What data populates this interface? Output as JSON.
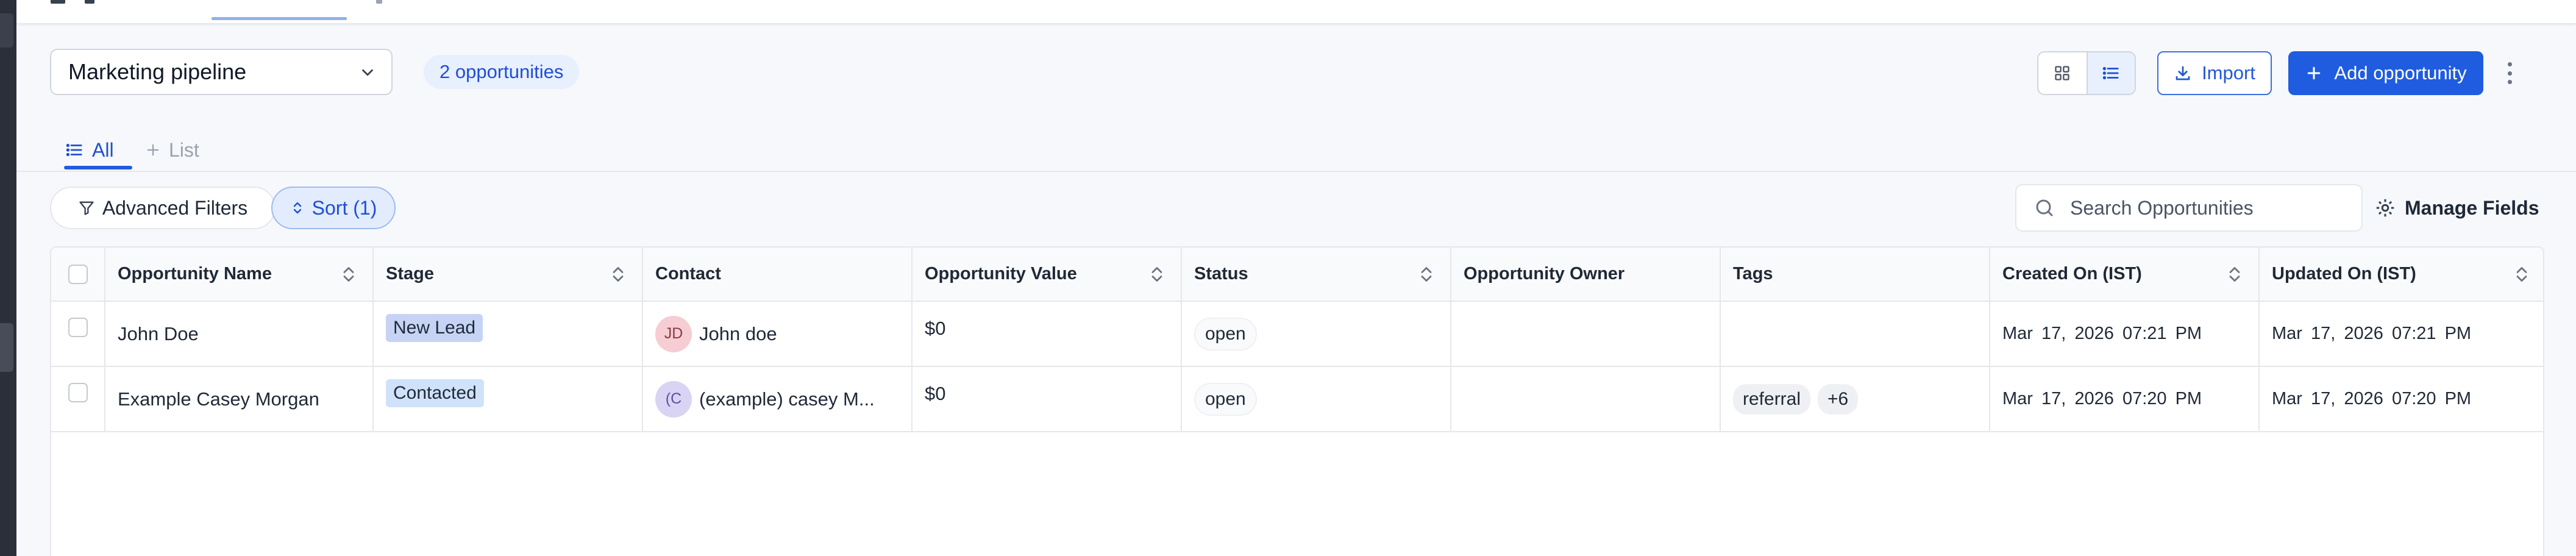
{
  "colors": {
    "accent": "#1f5ce0",
    "accent_light": "#e8f0fd",
    "border": "#e5e7eb",
    "rail": "#2b2f3a"
  },
  "header": {
    "pipeline_select": "Marketing pipeline",
    "opportunity_count": "2 opportunities",
    "import_label": "Import",
    "add_label": "Add opportunity"
  },
  "tabs": {
    "all": "All",
    "add_list": "List"
  },
  "toolbar": {
    "filters_label": "Advanced Filters",
    "sort_label": "Sort (1)",
    "search_placeholder": "Search Opportunities",
    "manage_fields_label": "Manage Fields"
  },
  "table": {
    "columns": [
      "Opportunity Name",
      "Stage",
      "Contact",
      "Opportunity Value",
      "Status",
      "Opportunity Owner",
      "Tags",
      "Created On (IST)",
      "Updated On (IST)"
    ],
    "rows": [
      {
        "name": "John Doe",
        "stage": "New Lead",
        "contact_initials": "JD",
        "contact_name": "John doe",
        "value": "$0",
        "status": "open",
        "owner": "",
        "tags": [],
        "tags_more": "",
        "created": "Mar 17, 2026 07:21 PM",
        "updated": "Mar 17, 2026 07:21 PM"
      },
      {
        "name": "Example Casey Morgan",
        "stage": "Contacted",
        "contact_initials": "(C",
        "contact_name": "(example) casey M...",
        "value": "$0",
        "status": "open",
        "owner": "",
        "tags": [
          "referral"
        ],
        "tags_more": "+6",
        "created": "Mar 17, 2026 07:20 PM",
        "updated": "Mar 17, 2026 07:20 PM"
      }
    ]
  }
}
